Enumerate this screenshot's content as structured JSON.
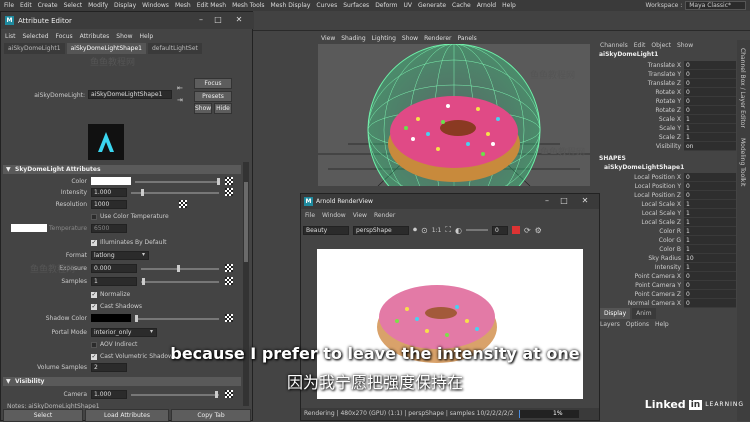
{
  "menubar": {
    "items": [
      "File",
      "Edit",
      "Create",
      "Select",
      "Modify",
      "Display",
      "Windows",
      "Mesh",
      "Edit Mesh",
      "Mesh Tools",
      "Mesh Display",
      "Curves",
      "Surfaces",
      "Deform",
      "UV",
      "Generate",
      "Cache",
      "Arnold",
      "Help"
    ],
    "workspace_label": "Workspace :",
    "workspace_value": "Maya Classic*"
  },
  "attr_editor": {
    "title": "Attribute Editor",
    "menu": [
      "List",
      "Selected",
      "Focus",
      "Attributes",
      "Show",
      "Help"
    ],
    "tabs": [
      "aiSkyDomeLight1",
      "aiSkyDomeLightShape1",
      "defaultLightSet"
    ],
    "node_label": "aiSkyDomeLight:",
    "node_value": "aiSkyDomeLightShape1",
    "focus": "Focus",
    "presets": "Presets",
    "show": "Show",
    "hide": "Hide",
    "section1": "SkyDomeLight Attributes",
    "color_label": "Color",
    "intensity_label": "Intensity",
    "intensity_value": "1.000",
    "resolution_label": "Resolution",
    "resolution_value": "1000",
    "use_color_temp": "Use Color Temperature",
    "temperature_label": "Temperature",
    "temperature_value": "6500",
    "illum_default": "Illuminates By Default",
    "format_label": "Format",
    "format_value": "latlong",
    "exposure_label": "Exposure",
    "exposure_value": "0.000",
    "samples_label": "Samples",
    "samples_value": "1",
    "normalize": "Normalize",
    "cast_shadows": "Cast Shadows",
    "shadow_color_label": "Shadow Color",
    "portal_label": "Portal Mode",
    "portal_value": "interior_only",
    "aov_indirect": "AOV Indirect",
    "cast_vol_shadows": "Cast Volumetric Shadows",
    "vol_samples_label": "Volume Samples",
    "vol_samples_value": "2",
    "section2": "Visibility",
    "camera_label": "Camera",
    "camera_value": "1.000",
    "notes": "Notes: aiSkyDomeLightShape1",
    "select": "Select",
    "load": "Load Attributes",
    "copy": "Copy Tab"
  },
  "viewport": {
    "menu": [
      "View",
      "Shading",
      "Lighting",
      "Show",
      "Renderer",
      "Panels"
    ]
  },
  "render_view": {
    "title": "Arnold RenderView",
    "menu": [
      "File",
      "Window",
      "View",
      "Render"
    ],
    "aov": "Beauty",
    "camera": "perspShape",
    "ratio": "1:1",
    "exposure": "0",
    "status": "Rendering | 480x270 (GPU) (1:1) | perspShape | samples 10/2/2/2/2/2",
    "progress": "1%"
  },
  "channel_box": {
    "menu": [
      "Channels",
      "Edit",
      "Object",
      "Show"
    ],
    "object": "aiSkyDomeLight1",
    "attrs": [
      [
        "Translate X",
        "0"
      ],
      [
        "Translate Y",
        "0"
      ],
      [
        "Translate Z",
        "0"
      ],
      [
        "Rotate X",
        "0"
      ],
      [
        "Rotate Y",
        "0"
      ],
      [
        "Rotate Z",
        "0"
      ],
      [
        "Scale X",
        "1"
      ],
      [
        "Scale Y",
        "1"
      ],
      [
        "Scale Z",
        "1"
      ],
      [
        "Visibility",
        "on"
      ]
    ],
    "shapes_header": "SHAPES",
    "shape": "aiSkyDomeLightShape1",
    "shape_attrs": [
      [
        "Local Position X",
        "0"
      ],
      [
        "Local Position Y",
        "0"
      ],
      [
        "Local Position Z",
        "0"
      ],
      [
        "Local Scale X",
        "1"
      ],
      [
        "Local Scale Y",
        "1"
      ],
      [
        "Local Scale Z",
        "1"
      ],
      [
        "Color R",
        "1"
      ],
      [
        "Color G",
        "1"
      ],
      [
        "Color B",
        "1"
      ],
      [
        "Sky Radius",
        "10"
      ],
      [
        "Intensity",
        "1"
      ],
      [
        "Point Camera X",
        "0"
      ],
      [
        "Point Camera Y",
        "0"
      ],
      [
        "Point Camera Z",
        "0"
      ],
      [
        "Normal Camera X",
        "0"
      ]
    ],
    "layer_tabs": [
      "Display",
      "Anim"
    ],
    "layer_menu": [
      "Layers",
      "Options",
      "Help"
    ]
  },
  "side_tabs": [
    "Channel Box / Layer Editor",
    "Modeling Toolkit"
  ],
  "subtitles": {
    "en": "because I prefer to leave the intensity at one",
    "zh": "因为我宁愿把强度保持在"
  },
  "branding": {
    "linked": "Linked",
    "in": "in",
    "learning": "LEARNING"
  },
  "watermark": "鱼鱼教程网"
}
